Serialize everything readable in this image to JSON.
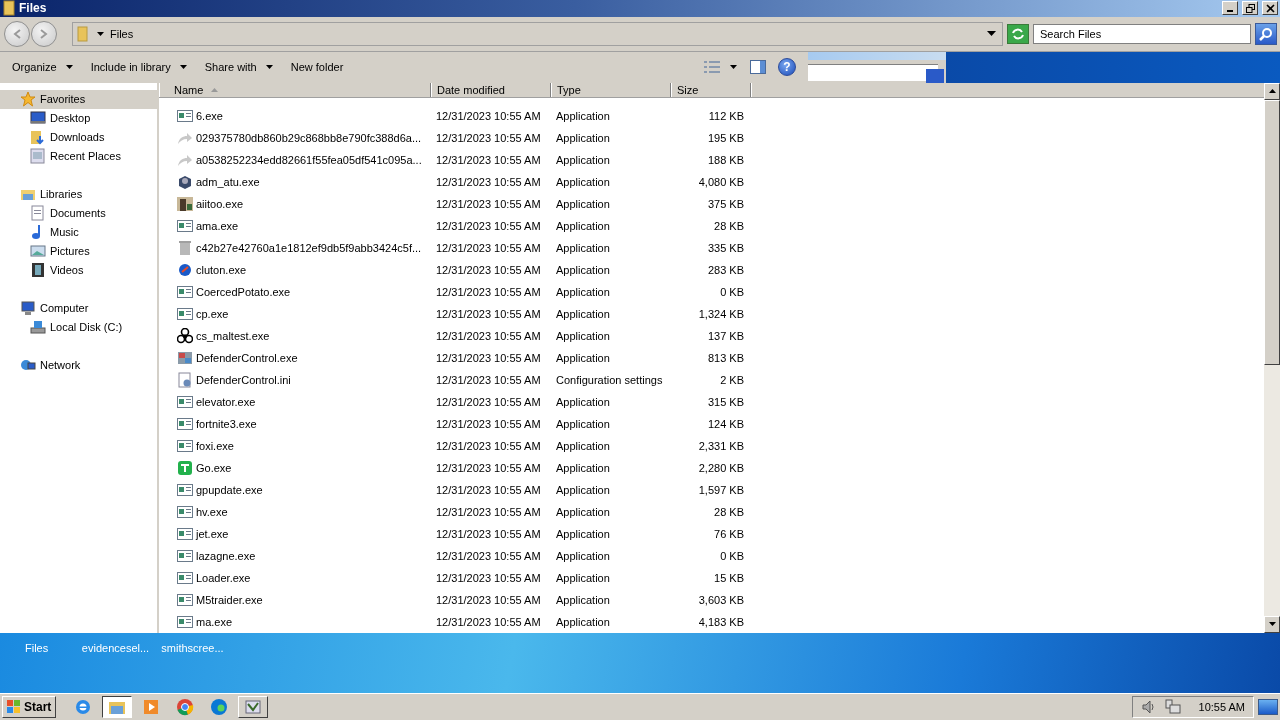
{
  "window": {
    "title": "Files"
  },
  "address": {
    "location": "Files"
  },
  "search": {
    "placeholder": "Search Files"
  },
  "toolbar": {
    "buttons": [
      {
        "label": "Organize",
        "menu": true
      },
      {
        "label": "Include in library",
        "menu": true
      },
      {
        "label": "Share with",
        "menu": true
      },
      {
        "label": "New folder",
        "menu": false
      }
    ],
    "help": "?"
  },
  "sidebar": {
    "groups": [
      {
        "label": "Favorites",
        "kind": "star",
        "selected": true,
        "children": [
          {
            "label": "Desktop",
            "kind": "desktop",
            "selected": false
          },
          {
            "label": "Downloads",
            "kind": "downloads",
            "selected": false
          },
          {
            "label": "Recent Places",
            "kind": "recent",
            "selected": false
          }
        ]
      },
      {
        "label": "Libraries",
        "kind": "library",
        "selected": false,
        "children": [
          {
            "label": "Documents",
            "kind": "documents",
            "selected": false
          },
          {
            "label": "Music",
            "kind": "music",
            "selected": false
          },
          {
            "label": "Pictures",
            "kind": "pictures",
            "selected": false
          },
          {
            "label": "Videos",
            "kind": "videos",
            "selected": false
          }
        ]
      },
      {
        "label": "Computer",
        "kind": "computer",
        "selected": false,
        "children": [
          {
            "label": "Local Disk (C:)",
            "kind": "disk",
            "selected": false
          }
        ]
      },
      {
        "label": "Network",
        "kind": "network",
        "selected": false
      }
    ]
  },
  "table": {
    "columns": [
      {
        "label": "Name",
        "sorted": true
      },
      {
        "label": "Date modified",
        "sorted": false
      },
      {
        "label": "Type",
        "sorted": false
      },
      {
        "label": "Size",
        "sorted": false
      }
    ],
    "rows": [
      {
        "name": "6.exe",
        "kind": "app",
        "date": "12/31/2023 10:55 AM",
        "type": "Application",
        "size": "112 KB"
      },
      {
        "name": "029375780db860b29c868bb8e790fc388d6a...",
        "kind": "arrow",
        "date": "12/31/2023 10:55 AM",
        "type": "Application",
        "size": "195 KB"
      },
      {
        "name": "a0538252234edd82661f55fea05df541c095a...",
        "kind": "arrow",
        "date": "12/31/2023 10:55 AM",
        "type": "Application",
        "size": "188 KB"
      },
      {
        "name": "adm_atu.exe",
        "kind": "box",
        "date": "12/31/2023 10:55 AM",
        "type": "Application",
        "size": "4,080 KB"
      },
      {
        "name": "aiitoo.exe",
        "kind": "photo",
        "date": "12/31/2023 10:55 AM",
        "type": "Application",
        "size": "375 KB"
      },
      {
        "name": "ama.exe",
        "kind": "app",
        "date": "12/31/2023 10:55 AM",
        "type": "Application",
        "size": "28 KB"
      },
      {
        "name": "c42b27e42760a1e1812ef9db5f9abb3424c5f...",
        "kind": "bin",
        "date": "12/31/2023 10:55 AM",
        "type": "Application",
        "size": "335 KB"
      },
      {
        "name": "cluton.exe",
        "kind": "globe",
        "date": "12/31/2023 10:55 AM",
        "type": "Application",
        "size": "283 KB"
      },
      {
        "name": "CoercedPotato.exe",
        "kind": "app",
        "date": "12/31/2023 10:55 AM",
        "type": "Application",
        "size": "0 KB"
      },
      {
        "name": "cp.exe",
        "kind": "app",
        "date": "12/31/2023 10:55 AM",
        "type": "Application",
        "size": "1,324 KB"
      },
      {
        "name": "cs_maltest.exe",
        "kind": "biohazard",
        "date": "12/31/2023 10:55 AM",
        "type": "Application",
        "size": "137 KB"
      },
      {
        "name": "DefenderControl.exe",
        "kind": "shield",
        "date": "12/31/2023 10:55 AM",
        "type": "Application",
        "size": "813 KB"
      },
      {
        "name": "DefenderControl.ini",
        "kind": "settings",
        "date": "12/31/2023 10:55 AM",
        "type": "Configuration settings",
        "size": "2 KB"
      },
      {
        "name": "elevator.exe",
        "kind": "app",
        "date": "12/31/2023 10:55 AM",
        "type": "Application",
        "size": "315 KB"
      },
      {
        "name": "fortnite3.exe",
        "kind": "app",
        "date": "12/31/2023 10:55 AM",
        "type": "Application",
        "size": "124 KB"
      },
      {
        "name": "foxi.exe",
        "kind": "app",
        "date": "12/31/2023 10:55 AM",
        "type": "Application",
        "size": "2,331 KB"
      },
      {
        "name": "Go.exe",
        "kind": "go",
        "date": "12/31/2023 10:55 AM",
        "type": "Application",
        "size": "2,280 KB"
      },
      {
        "name": "gpupdate.exe",
        "kind": "app",
        "date": "12/31/2023 10:55 AM",
        "type": "Application",
        "size": "1,597 KB"
      },
      {
        "name": "hv.exe",
        "kind": "app",
        "date": "12/31/2023 10:55 AM",
        "type": "Application",
        "size": "28 KB"
      },
      {
        "name": "jet.exe",
        "kind": "app",
        "date": "12/31/2023 10:55 AM",
        "type": "Application",
        "size": "76 KB"
      },
      {
        "name": "lazagne.exe",
        "kind": "app",
        "date": "12/31/2023 10:55 AM",
        "type": "Application",
        "size": "0 KB"
      },
      {
        "name": "Loader.exe",
        "kind": "app",
        "date": "12/31/2023 10:55 AM",
        "type": "Application",
        "size": "15 KB"
      },
      {
        "name": "M5traider.exe",
        "kind": "app",
        "date": "12/31/2023 10:55 AM",
        "type": "Application",
        "size": "3,603 KB"
      },
      {
        "name": "ma.exe",
        "kind": "app",
        "date": "12/31/2023 10:55 AM",
        "type": "Application",
        "size": "4,183 KB"
      }
    ]
  },
  "desktop": {
    "icons": [
      {
        "label": "Files"
      },
      {
        "label": "evidencesel..."
      },
      {
        "label": "smithscree..."
      }
    ]
  },
  "taskbar": {
    "start": "Start",
    "apps": [
      {
        "kind": "ie",
        "active": false,
        "open": false
      },
      {
        "kind": "explorer",
        "active": true,
        "open": false
      },
      {
        "kind": "media",
        "active": false,
        "open": false
      },
      {
        "kind": "chrome",
        "active": false,
        "open": false
      },
      {
        "kind": "edge",
        "active": false,
        "open": false
      },
      {
        "kind": "app",
        "active": false,
        "open": true
      }
    ],
    "clock": "10:55 AM"
  }
}
